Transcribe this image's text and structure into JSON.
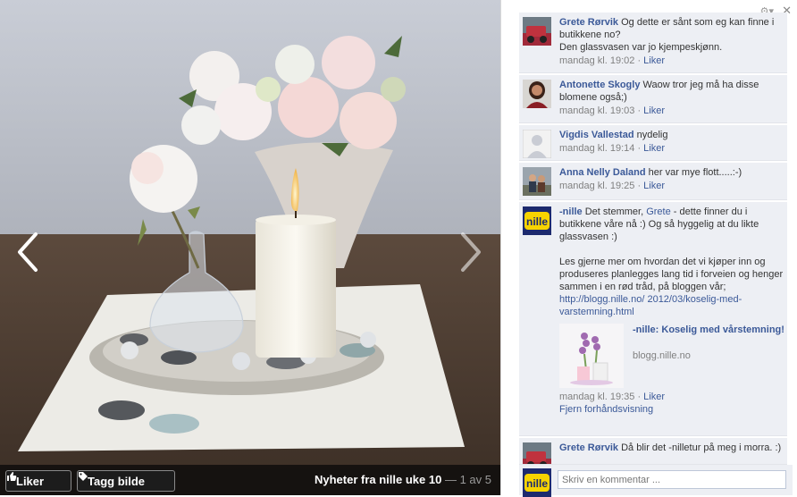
{
  "photo": {
    "prev_label": "Previous photo",
    "next_label": "Next photo"
  },
  "bottom_bar": {
    "like_label": "Liker",
    "tag_label": "Tagg bilde",
    "album_title": "Nyheter fra nille uke 10",
    "separator": "—",
    "counter": "1 av 5"
  },
  "sidebar": {
    "settings_icon": "⚙▾",
    "close_icon": "✕",
    "comments": [
      {
        "author": "Grete Rørvik",
        "text": "Og dette er sånt som eg kan finne i butikkene no?",
        "text2": "Den glassvasen var jo kjempeskjønn.",
        "time": "mandag kl. 19:02",
        "like": "Liker"
      },
      {
        "author": "Antonette Skogly",
        "text": "Waow tror jeg må ha disse blomene også;)",
        "time": "mandag kl. 19:03",
        "like": "Liker"
      },
      {
        "author": "Vigdis Vallestad",
        "text": "nydelig",
        "time": "mandag kl. 19:14",
        "like": "Liker"
      },
      {
        "author": "Anna Nelly Daland",
        "text": "her var mye flott.....:-)",
        "time": "mandag kl. 19:25",
        "like": "Liker"
      },
      {
        "author": "-nille",
        "text_pre": "Det stemmer,",
        "mention": "Grete",
        "text_post": "- dette finner du i butikkene våre nå :) Og så hyggelig at du likte glassvasen :)",
        "text2": "Les gjerne mer om hvordan det vi kjøper inn og produseres planlegges lang tid i forveien og henger sammen i en rød tråd, på bloggen vår;",
        "url": "http://blogg.nille.no/ 2012/03/koselig-med-varstemning.html",
        "preview_title": "-nille: Koselig med vårstemning!",
        "preview_domain": "blogg.nille.no",
        "time": "mandag kl. 19:35",
        "like": "Liker",
        "remove_preview": "Fjern forhåndsvisning"
      },
      {
        "author": "Grete Rørvik",
        "text": "Då blir det -nilletur på meg i morra. :)"
      }
    ],
    "composer": {
      "placeholder": "Skriv en kommentar ..."
    }
  },
  "colors": {
    "link": "#3b5998",
    "comment_bg": "#edeff4"
  }
}
